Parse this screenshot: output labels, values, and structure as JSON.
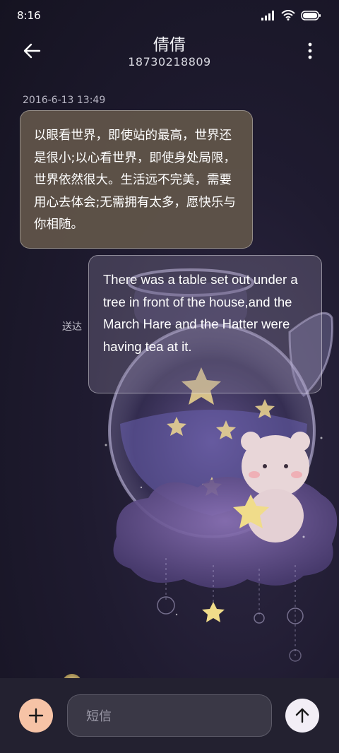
{
  "status_bar": {
    "time": "8:16"
  },
  "header": {
    "contact_name": "倩倩",
    "contact_number": "18730218809"
  },
  "conversation": {
    "timestamp": "2016-6-13 13:49",
    "messages": [
      {
        "direction": "incoming",
        "text": "以眼看世界，即使站的最高，世界还是很小;以心看世界，即使身处局限，世界依然很大。生活远不完美，需要用心去体会;无需拥有太多，愿快乐与你相随。"
      },
      {
        "direction": "outgoing",
        "text": "There was a table set out under a tree in front of the house,and the March Hare and the Hatter were having tea at it.",
        "status": "送达"
      }
    ]
  },
  "composer": {
    "placeholder": "短信"
  },
  "icons": {
    "back": "arrow-left-icon",
    "more": "more-vertical-icon",
    "add": "plus-icon",
    "send": "arrow-up-icon",
    "signal": "signal-icon",
    "wifi": "wifi-icon",
    "battery": "battery-icon"
  },
  "colors": {
    "add_button": "#f6c3a6",
    "send_button": "#f2eef6",
    "incoming_bubble": "#62564a"
  }
}
